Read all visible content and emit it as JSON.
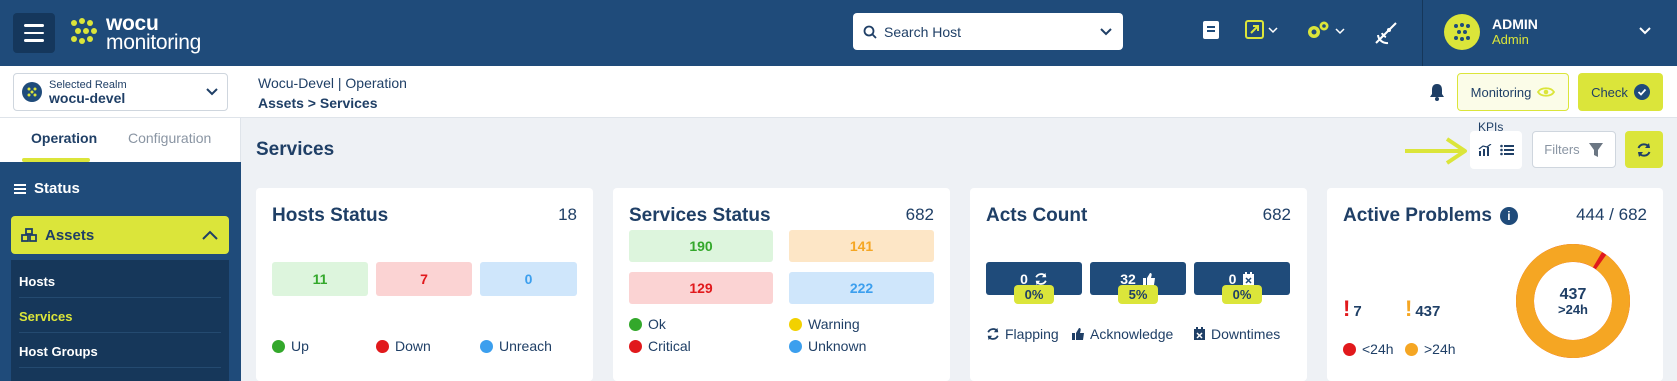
{
  "header": {
    "logo_line1": "wocu",
    "logo_line2": "monitoring",
    "search_placeholder": "Search Host",
    "user_name": "ADMIN",
    "user_role": "Admin"
  },
  "subbar": {
    "realm_label": "Selected Realm",
    "realm_value": "wocu-devel",
    "crumb_line1": "Wocu-Devel | Operation",
    "crumb_line2": "Assets > Services",
    "monitoring_label": "Monitoring",
    "check_label": "Check"
  },
  "sidebar": {
    "tabs": [
      "Operation",
      "Configuration"
    ],
    "status_label": "Status",
    "assets_label": "Assets",
    "sub_items": [
      "Hosts",
      "Services",
      "Host Groups"
    ]
  },
  "main": {
    "title": "Services",
    "kpis_label": "KPIs",
    "filters_label": "Filters"
  },
  "cards": {
    "hosts": {
      "title": "Hosts Status",
      "count": "18",
      "values": [
        "11",
        "7",
        "0"
      ],
      "legend": [
        "Up",
        "Down",
        "Unreach"
      ]
    },
    "services": {
      "title": "Services Status",
      "count": "682",
      "values": [
        "190",
        "141",
        "129",
        "222"
      ],
      "legend": [
        "Ok",
        "Warning",
        "Critical",
        "Unknown"
      ]
    },
    "acts": {
      "title": "Acts Count",
      "count": "682",
      "values": [
        "0",
        "32",
        "0"
      ],
      "pcts": [
        "0%",
        "5%",
        "0%"
      ],
      "legend": [
        "Flapping",
        "Acknowledge",
        "Downtimes"
      ]
    },
    "problems": {
      "title": "Active Problems",
      "count": "444 / 682",
      "lt24": "7",
      "gt24": "437",
      "legend": [
        "<24h",
        ">24h"
      ],
      "donut_value": "437",
      "donut_label": ">24h",
      "donut_fraction": 0.984
    }
  },
  "colors": {
    "primary": "#1f4b7a",
    "accent": "#dbe53a",
    "ok_bg": "#ddf5dd",
    "ok_fg": "#33a82b",
    "crit_bg": "#fbd3d3",
    "crit_fg": "#e1191c",
    "unk_bg": "#cfe6fb",
    "unk_fg": "#3c9fee",
    "warn_bg": "#fde6c6",
    "warn_fg": "#f5a623"
  }
}
